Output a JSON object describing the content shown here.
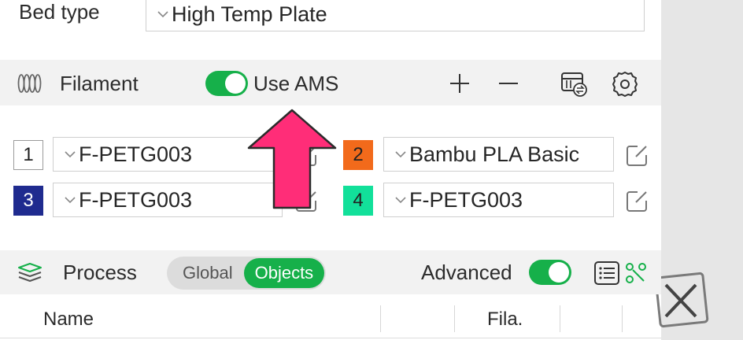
{
  "bed": {
    "label": "Bed type",
    "value": "High Temp Plate"
  },
  "filament": {
    "title": "Filament",
    "use_ams_label": "Use AMS",
    "use_ams_on": true,
    "icons": [
      "filament-spools-icon",
      "plus-icon",
      "minus-icon",
      "ams-sync-icon",
      "settings-gear-icon"
    ],
    "slots": [
      {
        "number": "1",
        "value": "F-PETG003",
        "color": "#ffffff",
        "text_color": "#222222"
      },
      {
        "number": "2",
        "value": "Bambu PLA Basic",
        "color": "#f26a1b",
        "text_color": "#222222"
      },
      {
        "number": "3",
        "value": "F-PETG003",
        "color": "#1f2b8f",
        "text_color": "#ffffff"
      },
      {
        "number": "4",
        "value": "F-PETG003",
        "color": "#12e09a",
        "text_color": "#222222"
      }
    ]
  },
  "process": {
    "title": "Process",
    "seg_global": "Global",
    "seg_objects": "Objects",
    "advanced_label": "Advanced",
    "advanced_on": true
  },
  "objects_table": {
    "columns": [
      "Name",
      "",
      "",
      "Fila.",
      "",
      ""
    ]
  },
  "annotation": {
    "arrow_color": "#ff2d78"
  }
}
